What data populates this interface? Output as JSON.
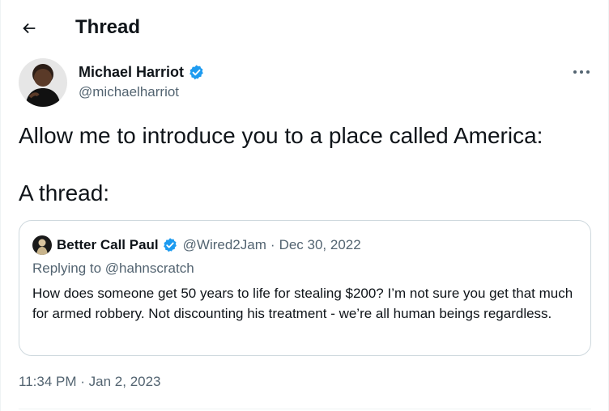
{
  "header": {
    "title": "Thread",
    "back_icon": "arrow-left-icon"
  },
  "tweet": {
    "author": {
      "name": "Michael Harriot",
      "handle": "@michaelharriot",
      "verified": true
    },
    "text_line_1": "Allow me to introduce you to a place called America:",
    "text_line_2": "A thread:",
    "time": "11:34 PM",
    "separator": "·",
    "date": "Jan 2, 2023",
    "more_icon": "ellipsis-icon"
  },
  "quote": {
    "author": {
      "name": "Better Call Paul",
      "handle": "@Wired2Jam",
      "verified": true
    },
    "separator": "·",
    "date": "Dec 30, 2022",
    "replying_prefix": "Replying to",
    "replying_to": "@hahnscratch",
    "text": "How does someone get 50 years to life for stealing $200? I’m not sure you get that much for armed robbery. Not discounting his treatment - we’re all human beings regardless."
  },
  "colors": {
    "text_primary": "#0f1419",
    "text_secondary": "#536471",
    "verified_blue": "#1d9bf0",
    "border": "#cfd9de"
  }
}
